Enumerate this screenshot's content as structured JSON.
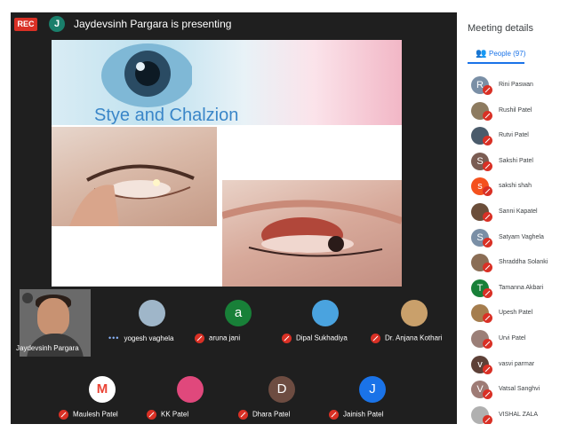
{
  "recording_badge": "REC",
  "presenter": {
    "avatar_letter": "J",
    "banner_text": "Jaydevsinh Pargara is presenting"
  },
  "slide": {
    "title": "Stye and Chalzion"
  },
  "self_view": {
    "name": "Jaydevsinh Pargara"
  },
  "participant_tiles": [
    {
      "name": "yogesh vaghela",
      "status": "more",
      "avatar": "photo",
      "color": "#9fb6c9"
    },
    {
      "name": "aruna jani",
      "status": "muted",
      "avatar": "a",
      "color": "#188038"
    },
    {
      "name": "Dipal Sukhadiya",
      "status": "muted",
      "avatar": "photo",
      "color": "#4aa3df"
    },
    {
      "name": "Dr. Anjana Kothari",
      "status": "muted",
      "avatar": "photo",
      "color": "#c9a06b"
    },
    {
      "name": "Maulesh Patel",
      "status": "muted",
      "avatar": "M",
      "color": "#ffffff"
    },
    {
      "name": "KK Patel",
      "status": "muted",
      "avatar": "photo",
      "color": "#e0487c"
    },
    {
      "name": "Dhara Patel",
      "status": "muted",
      "avatar": "D",
      "color": "#6d4c41"
    },
    {
      "name": "Jainish Patel",
      "status": "muted",
      "avatar": "J",
      "color": "#1a73e8"
    }
  ],
  "panel": {
    "title": "Meeting details",
    "people_tab": "People (97)",
    "people": [
      {
        "name": "Rini Paswan",
        "letter": "R",
        "color": "#7a8fa6"
      },
      {
        "name": "Rushil Patel",
        "letter": "",
        "color": "#8d7b60"
      },
      {
        "name": "Rutvi Patel",
        "letter": "",
        "color": "#4a5b6b"
      },
      {
        "name": "Sakshi Patel",
        "letter": "S",
        "color": "#7a5c52"
      },
      {
        "name": "sakshi shah",
        "letter": "s",
        "color": "#f4511e"
      },
      {
        "name": "Sanni Kapatel",
        "letter": "",
        "color": "#6b4e3a"
      },
      {
        "name": "Satyam Vaghela",
        "letter": "S",
        "color": "#7a8fa6"
      },
      {
        "name": "Shraddha Solanki",
        "letter": "",
        "color": "#8a6d55"
      },
      {
        "name": "Tamanna Akbari",
        "letter": "T",
        "color": "#188038"
      },
      {
        "name": "Upesh Patel",
        "letter": "",
        "color": "#a57d4e"
      },
      {
        "name": "Urvi Patel",
        "letter": "",
        "color": "#9b7f77"
      },
      {
        "name": "vasvi parmar",
        "letter": "v",
        "color": "#5d4037"
      },
      {
        "name": "Vatsal Sanghvi",
        "letter": "V",
        "color": "#9e7b75"
      },
      {
        "name": "VISHAL ZALA",
        "letter": "",
        "color": "#b0b0b0"
      }
    ]
  }
}
